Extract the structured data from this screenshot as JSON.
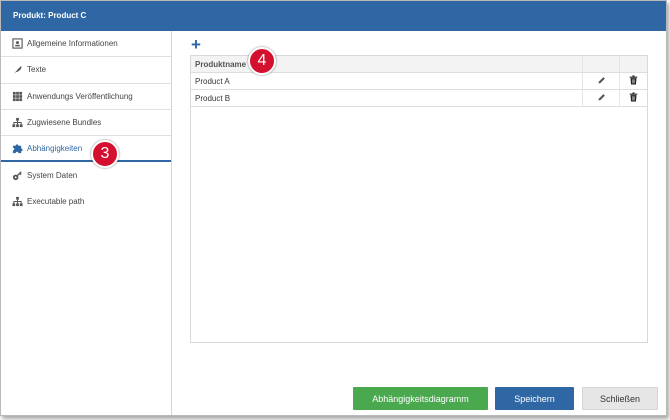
{
  "dialog": {
    "title": "Produkt: Product C"
  },
  "sidebar": {
    "items": [
      {
        "label": "Allgemeine Informationen",
        "icon": "id-card-icon"
      },
      {
        "label": "Texte",
        "icon": "feather-icon"
      },
      {
        "label": "Anwendungs Veröffentlichung",
        "icon": "grid-icon"
      },
      {
        "label": "Zugwiesene Bundles",
        "icon": "hierarchy-icon"
      },
      {
        "label": "Abhängigkeiten",
        "icon": "puzzle-icon",
        "active": true
      },
      {
        "label": "System Daten",
        "icon": "key-icon"
      },
      {
        "label": "Executable path",
        "icon": "hierarchy-icon"
      }
    ]
  },
  "badges": {
    "three": "3",
    "four": "4"
  },
  "grid": {
    "add_symbol": "+",
    "header": "Produktname",
    "rows": [
      {
        "name": "Product A"
      },
      {
        "name": "Product B"
      }
    ]
  },
  "footer": {
    "diagram_label": "Abhängigkeitsdiagramm",
    "save_label": "Speichern",
    "close_label": "Schließen"
  },
  "colors": {
    "titlebar": "#2e67a3",
    "accent": "#2e67a3",
    "diagram_button": "#4aa84e",
    "badge": "#d3102e"
  }
}
